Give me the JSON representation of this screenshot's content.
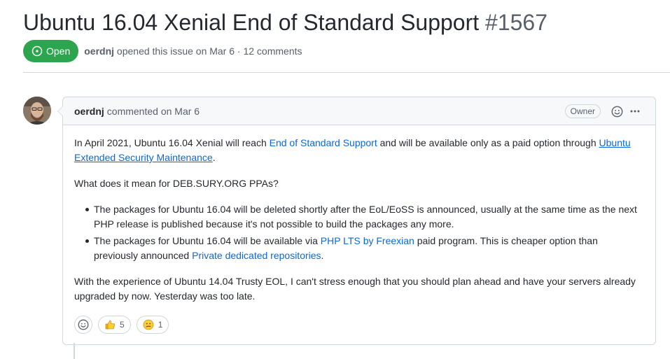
{
  "issue": {
    "title": "Ubuntu 16.04 Xenial End of Standard Support",
    "number": "#1567",
    "state": "Open",
    "author": "oerdnj",
    "opened_text": "opened this issue on Mar 6 · 12 comments"
  },
  "colors": {
    "open_green": "#2da44e",
    "link_blue": "#0969da",
    "muted": "#57606a",
    "border": "#d0d7de"
  },
  "comment": {
    "author": "oerdnj",
    "when": "commented on Mar 6",
    "owner_label": "Owner",
    "icons": [
      "smiley-icon",
      "kebab-icon"
    ],
    "p1_a": "In April 2021, Ubuntu 16.04 Xenial will reach ",
    "p1_link1": "End of Standard Support",
    "p1_b": " and will be available only as a paid option through ",
    "p1_link2": "Ubuntu Extended Security Maintenance",
    "p1_c": ".",
    "p2": "What does it mean for DEB.SURY.ORG PPAs?",
    "bullet1": "The packages for Ubuntu 16.04 will be deleted shortly after the EoL/EoSS is announced, usually at the same time as the next PHP release is published because it's not possible to build the packages any more.",
    "bullet2_a": "The packages for Ubuntu 16.04 will be available via ",
    "bullet2_link1": "PHP LTS by Freexian",
    "bullet2_b": " paid program. This is cheaper option than previously announced ",
    "bullet2_link2": "Private dedicated repositories",
    "bullet2_c": ".",
    "p3": "With the experience of Ubuntu 14.04 Trusty EOL, I can't stress enough that you should plan ahead and have your servers already upgraded by now. Yesterday was too late.",
    "reactions": [
      {
        "icon": "thumbs-up-icon",
        "count": "5"
      },
      {
        "icon": "confused-icon",
        "count": "1"
      }
    ]
  }
}
